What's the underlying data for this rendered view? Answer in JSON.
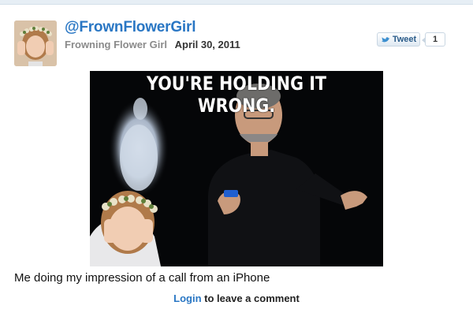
{
  "post": {
    "handle": "@FrownFlowerGirl",
    "display_name": "Frowning Flower Girl",
    "date": "April 30, 2011",
    "tweet_label": "Tweet",
    "tweet_count": "1",
    "image_overlay_text": "YOU'RE HOLDING IT WRONG.",
    "caption": "Me doing my impression of a call from an iPhone"
  },
  "comments": {
    "login_label": "Login",
    "suffix": " to leave a comment"
  },
  "colors": {
    "link": "#2a77c4",
    "photo_background": "#050608",
    "top_rule": "#e6eef5"
  },
  "icons": {
    "tweet_button": "twitter-bird-icon"
  }
}
